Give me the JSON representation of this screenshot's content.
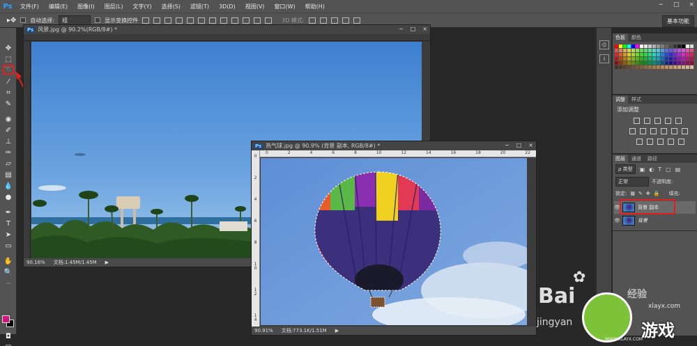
{
  "app": {
    "logo": "Ps"
  },
  "menu": [
    "文件(F)",
    "编辑(E)",
    "图像(I)",
    "图层(L)",
    "文字(Y)",
    "选择(S)",
    "滤镜(T)",
    "3D(D)",
    "视图(V)",
    "窗口(W)",
    "帮助(H)"
  ],
  "window_controls": {
    "minimize": "−",
    "maximize": "□",
    "close": "×"
  },
  "options": {
    "auto_select_label": "自动选择:",
    "auto_select_value": "组",
    "show_transform_label": "显示变换控件",
    "mode_3d_label": "3D 模式:",
    "workspace_button": "基本功能"
  },
  "doc1": {
    "title": "风景.jpg @ 90.2%(RGB/8#) *",
    "zoom": "90.16%",
    "file_info": "文档:1.45M/1.45M"
  },
  "doc2": {
    "title": "热气球.jpg @ 90.9% (背景 副本, RGB/8#) *",
    "zoom": "90.91%",
    "file_info": "文档:773.1K/1.51M",
    "ruler_h": [
      "0",
      "2",
      "4",
      "6",
      "8",
      "10",
      "12",
      "14",
      "16",
      "18",
      "20",
      "22"
    ],
    "ruler_v": [
      "0",
      "2",
      "4",
      "6",
      "8",
      "1\n0",
      "1\n2",
      "1\n4"
    ]
  },
  "swatches_panel": {
    "tabs": [
      "色板",
      "颜色"
    ]
  },
  "adjust_panel": {
    "tabs": [
      "调整",
      "样式"
    ],
    "title": "添加调整"
  },
  "layers_panel": {
    "tabs": [
      "图层",
      "通道",
      "路径"
    ],
    "filter_kind": "ρ 类型",
    "blend_mode": "正常",
    "opacity_label": "不透明度:",
    "lock_label": "锁定:",
    "fill_label": "填充:",
    "layers": [
      {
        "name": "背景 副本",
        "selected": true
      },
      {
        "name": "背景",
        "selected": false
      }
    ]
  },
  "watermarks": {
    "baidu": "Bai",
    "baidu_suffix": "经验",
    "jingyan": "jingyan",
    "xlayx": "xlayx.com",
    "game_site": "游戏",
    "site_small": "WWW.XLAYX.COM"
  },
  "colors": {
    "accent_red": "#e02020",
    "fg_color": "#d4147a",
    "bg_color": "#000000"
  }
}
